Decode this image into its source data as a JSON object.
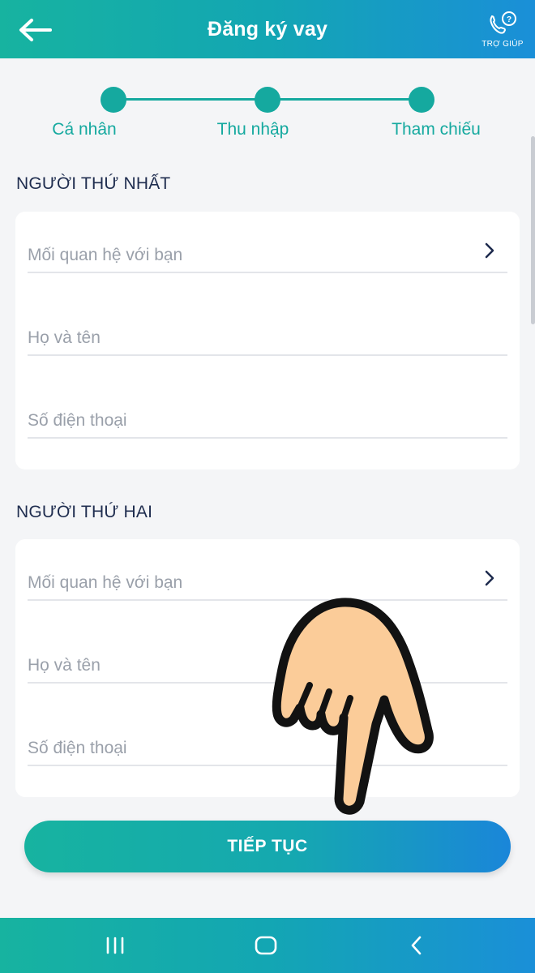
{
  "header": {
    "title": "Đăng ký vay",
    "help_label": "TRỢ GIÚP"
  },
  "stepper": {
    "steps": [
      {
        "label": "Cá nhân"
      },
      {
        "label": "Thu nhập"
      },
      {
        "label": "Tham chiếu"
      }
    ]
  },
  "sections": [
    {
      "title": "NGƯỜI THỨ NHẤT",
      "fields": [
        {
          "placeholder": "Mối quan hệ với bạn"
        },
        {
          "placeholder": "Họ và tên"
        },
        {
          "placeholder": "Số điện thoại"
        }
      ]
    },
    {
      "title": "NGƯỜI THỨ HAI",
      "fields": [
        {
          "placeholder": "Mối quan hệ với bạn"
        },
        {
          "placeholder": "Họ và tên"
        },
        {
          "placeholder": "Số điện thoại"
        }
      ]
    }
  ],
  "cta": {
    "label": "TIẾP TỤC"
  },
  "colors": {
    "accent": "#15a99f",
    "gradient_end": "#1a8fd8",
    "background": "#f4f5f7"
  },
  "icons": {
    "back": "arrow-left-icon",
    "help": "phone-help-icon",
    "chevron": "chevron-right-icon",
    "nav_recent": "recent-apps-icon",
    "nav_home": "home-icon",
    "nav_back": "nav-back-icon",
    "overlay": "pointing-hand-icon"
  }
}
